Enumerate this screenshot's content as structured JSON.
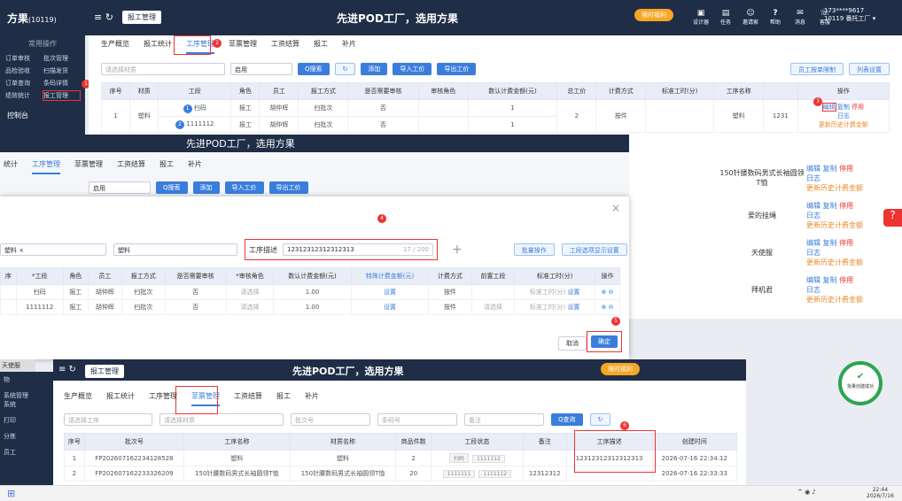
{
  "app": {
    "logo": "方果",
    "org_id": "(10119)",
    "breadcrumb": "报工管理",
    "slogan": "先进POD工厂，选用方果",
    "promo": "限时福利",
    "user_phone": "173****9617",
    "user_org": "10119 番托工厂"
  },
  "top_icons": [
    "设计器",
    "任务",
    "邀请家",
    "帮助",
    "消息",
    "客服"
  ],
  "sidebar": {
    "header": "常用操作",
    "items": [
      "订单审核",
      "批次管理",
      "品检验收",
      "扫描发货",
      "订单查询",
      "条码详情",
      "绩效统计",
      "报工管理"
    ],
    "control": "控制台"
  },
  "tabs": [
    "生产概览",
    "报工统计",
    "工序管理",
    "菲票管理",
    "工资结算",
    "报工",
    "补片"
  ],
  "main": {
    "filter": {
      "material_placeholder": "请选择材质",
      "status": "启用",
      "search": "Q搜索",
      "add": "添加",
      "import": "导入工价",
      "export": "导出工价",
      "btn_piece": "员工按单限制",
      "btn_cols": "列表设置"
    },
    "headers": [
      "序号",
      "材质",
      "工段",
      "角色",
      "员工",
      "报工方式",
      "是否需要审核",
      "审核角色",
      "数认计费金额(元)",
      "总工价",
      "计费方式",
      "标准工时(分)",
      "工序名称",
      "",
      "操作"
    ],
    "row1": {
      "no": "1",
      "material": "塑料",
      "proc1": "扫码",
      "role1": "报工",
      "emp1": "胡仲辉",
      "mode1": "扫批次",
      "audit1": "否",
      "amt1": "1",
      "proc2": "1111112",
      "role2": "报工",
      "emp2": "胡仲辉",
      "mode2": "扫批次",
      "audit2": "否",
      "amt2": "1",
      "total": "2",
      "billing": "按件",
      "name": "塑料",
      "std": "1231"
    },
    "row_names": [
      "150针腰数码男式长袖圆领T恤",
      "爱的挂绳",
      "天使服",
      "拜机君"
    ],
    "ops": {
      "edit": "编辑",
      "copy": "复制",
      "disable": "停用",
      "log": "日志",
      "update": "更新历史计费金额"
    }
  },
  "mid": {
    "slogan": "先进POD工厂，选用方果",
    "tabs": [
      "统计",
      "工序管理",
      "菲票管理",
      "工资结算",
      "报工",
      "补片"
    ],
    "status": "启用",
    "search": "Q搜索",
    "add": "添加",
    "import": "导入工价",
    "export": "导出工价"
  },
  "modal": {
    "material_tag": "塑料",
    "name": "塑料",
    "desc_label": "工序描述",
    "desc_value": "12312312312312313",
    "desc_count": "17 / 200",
    "batch": "批量操作",
    "display": "工段选项显示设置",
    "headers": [
      "序",
      "*工段",
      "角色",
      "员工",
      "报工方式",
      "是否需要审核",
      "*审核角色",
      "数认计费金额(元)",
      "特殊计费金额(元)",
      "计费方式",
      "前置工段",
      "标准工时(分)",
      "操作"
    ],
    "rows": [
      {
        "proc": "扫码",
        "role": "报工",
        "emp": "胡仲辉",
        "mode": "扫批次",
        "audit": "否",
        "arole": "请选择",
        "amt": "1.00",
        "special": "设置",
        "billing": "按件",
        "pre": "",
        "std": "标准工时(分)",
        "std_set": "设置"
      },
      {
        "proc": "1111112",
        "role": "报工",
        "emp": "胡仲辉",
        "mode": "扫批次",
        "audit": "否",
        "arole": "请选择",
        "amt": "1.00",
        "special": "设置",
        "billing": "按件",
        "pre": "请选择",
        "std": "标准工时(分)",
        "std_set": "设置"
      }
    ],
    "cancel": "取消",
    "confirm": "确定"
  },
  "bottom": {
    "breadcrumb": "报工管理",
    "slogan": "先进POD工厂，选用方果",
    "promo": "限时福利",
    "side_items": [
      "物",
      "系统管理",
      "系统",
      "打印",
      "分拣",
      "员工"
    ],
    "tabs": [
      "生产概览",
      "报工统计",
      "工序管理",
      "菲票管理",
      "工资结算",
      "报工",
      "补片"
    ],
    "filters": [
      "请选择工序",
      "请选择材质",
      "批次号",
      "条码号",
      "备注"
    ],
    "query": "Q查询",
    "headers": [
      "序号",
      "批次号",
      "工序名称",
      "材质名称",
      "商品件数",
      "工段状态",
      "备注",
      "工序描述",
      "创建时间"
    ],
    "rows": [
      {
        "no": "1",
        "batch": "FP202607162234128528",
        "proc": "塑料",
        "mat": "塑料",
        "qty": "2",
        "tags": [
          "扫码",
          "1111112"
        ],
        "note": "",
        "desc": "12312312312312313",
        "time": "2026-07-16 22:34:12"
      },
      {
        "no": "2",
        "batch": "FP202607162233326209",
        "proc": "150针腰数码男式长袖圆领T恤",
        "mat": "150针腰数码男式长袖圆领T恤",
        "qty": "20",
        "tags": [
          "1111111",
          "1111112"
        ],
        "note": "12312312",
        "desc": "",
        "time": "2026-07-16 22:33:33"
      }
    ],
    "tooltip": "天使服"
  },
  "success": {
    "label": "批量创建成功"
  },
  "markers": [
    "1",
    "2",
    "3",
    "4",
    "5",
    "6"
  ],
  "taskbar": {
    "time": "22:44",
    "date": "2026/7/16"
  }
}
